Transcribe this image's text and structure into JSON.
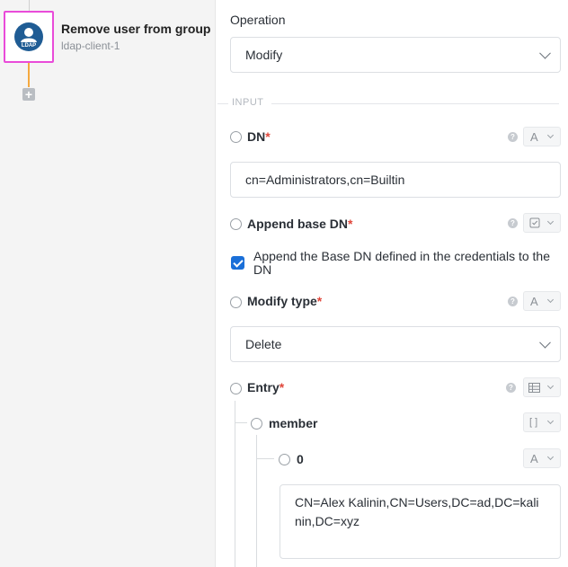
{
  "canvas": {
    "node": {
      "title": "Remove user from group",
      "subtitle": "ldap-client-1",
      "icon_text": "LDAP",
      "icon": "ldap-user-icon"
    },
    "add_icon": "plus-icon"
  },
  "form": {
    "operation_label": "Operation",
    "operation_value": "Modify",
    "section_label": "INPUT",
    "dn": {
      "label": "DN",
      "required": "*",
      "type": "A",
      "value": "cn=Administrators,cn=Builtin"
    },
    "append_base_dn": {
      "label": "Append base DN",
      "required": "*",
      "type_icon": "checkbox-icon",
      "checkbox_text": "Append the Base DN defined in the credentials to the DN"
    },
    "modify_type": {
      "label": "Modify type",
      "required": "*",
      "type": "A",
      "value": "Delete"
    },
    "entry": {
      "label": "Entry",
      "required": "*",
      "type_icon": "table-icon"
    },
    "member": {
      "label": "member",
      "type": "[ ]"
    },
    "item0": {
      "label": "0",
      "type": "A",
      "value": "CN=Alex Kalinin,CN=Users,DC=ad,DC=kalinin,DC=xyz"
    }
  },
  "colors": {
    "accent": "#1a6fd8",
    "node_border": "#e94bd9",
    "connector": "#f5a93f",
    "required": "#e0473b"
  }
}
